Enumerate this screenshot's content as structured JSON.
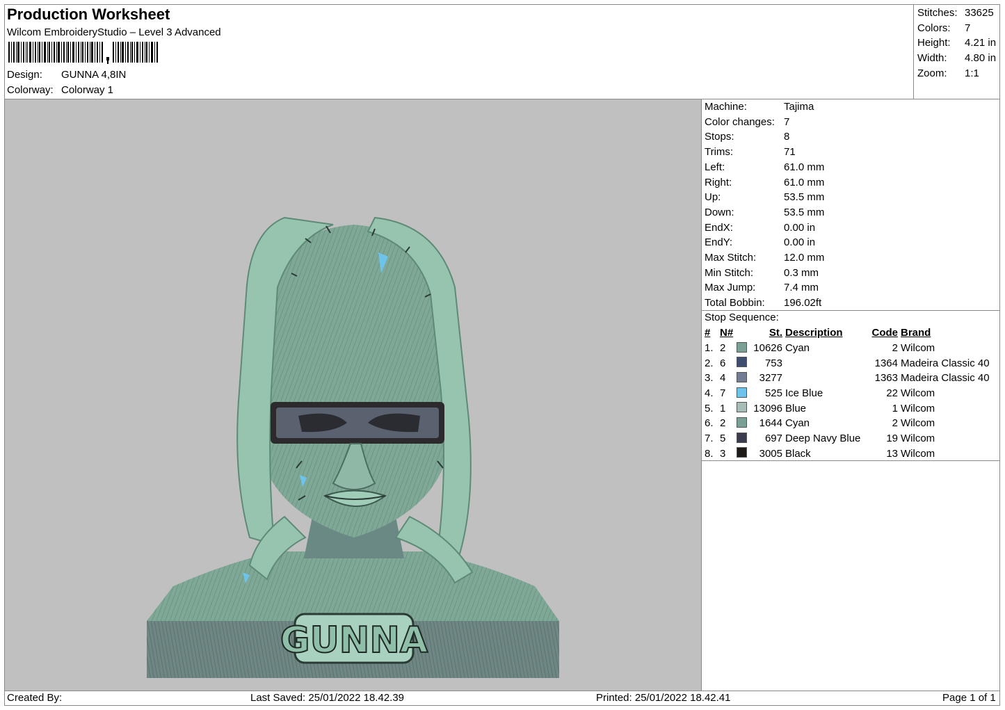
{
  "header": {
    "title": "Production Worksheet",
    "software": "Wilcom EmbroideryStudio – Level 3 Advanced",
    "design_label": "Design:",
    "design_value": "GUNNA 4,8IN",
    "colorway_label": "Colorway:",
    "colorway_value": "Colorway 1"
  },
  "summary": [
    {
      "label": "Stitches:",
      "value": "33625"
    },
    {
      "label": "Colors:",
      "value": "7"
    },
    {
      "label": "Height:",
      "value": "4.21 in"
    },
    {
      "label": "Width:",
      "value": "4.80 in"
    },
    {
      "label": "Zoom:",
      "value": "1:1"
    }
  ],
  "specs": [
    {
      "label": "Machine:",
      "value": "Tajima"
    },
    {
      "label": "Color changes:",
      "value": "7"
    },
    {
      "label": "Stops:",
      "value": "8"
    },
    {
      "label": "Trims:",
      "value": "71"
    },
    {
      "label": "Left:",
      "value": "61.0 mm"
    },
    {
      "label": "Right:",
      "value": "61.0 mm"
    },
    {
      "label": "Up:",
      "value": "53.5 mm"
    },
    {
      "label": "Down:",
      "value": "53.5 mm"
    },
    {
      "label": "EndX:",
      "value": "0.00 in"
    },
    {
      "label": "EndY:",
      "value": "0.00 in"
    },
    {
      "label": "Max Stitch:",
      "value": "12.0 mm"
    },
    {
      "label": "Min Stitch:",
      "value": "0.3 mm"
    },
    {
      "label": "Max Jump:",
      "value": "7.4 mm"
    },
    {
      "label": "Total Bobbin:",
      "value": "196.02ft"
    }
  ],
  "stop_sequence": {
    "label": "Stop Sequence:",
    "columns": [
      "#",
      "N#",
      "St.",
      "Description",
      "Code",
      "Brand"
    ],
    "rows": [
      {
        "idx": "1.",
        "n": "2",
        "color": "#7a9f94",
        "st": "10626",
        "desc": "Cyan",
        "code": "2",
        "brand": "Wilcom"
      },
      {
        "idx": "2.",
        "n": "6",
        "color": "#3d4e6e",
        "st": "753",
        "desc": "",
        "code": "1364",
        "brand": "Madeira Classic 40"
      },
      {
        "idx": "3.",
        "n": "4",
        "color": "#737c93",
        "st": "3277",
        "desc": "",
        "code": "1363",
        "brand": "Madeira Classic 40"
      },
      {
        "idx": "4.",
        "n": "7",
        "color": "#6ec3ea",
        "st": "525",
        "desc": "Ice Blue",
        "code": "22",
        "brand": "Wilcom"
      },
      {
        "idx": "5.",
        "n": "1",
        "color": "#a8bdb8",
        "st": "13096",
        "desc": "Blue",
        "code": "1",
        "brand": "Wilcom"
      },
      {
        "idx": "6.",
        "n": "2",
        "color": "#7a9f94",
        "st": "1644",
        "desc": "Cyan",
        "code": "2",
        "brand": "Wilcom"
      },
      {
        "idx": "7.",
        "n": "5",
        "color": "#3b3b4e",
        "st": "697",
        "desc": "Deep Navy Blue",
        "code": "19",
        "brand": "Wilcom"
      },
      {
        "idx": "8.",
        "n": "3",
        "color": "#1e1a18",
        "st": "3005",
        "desc": "Black",
        "code": "13",
        "brand": "Wilcom"
      }
    ]
  },
  "design_text": "GUNNA",
  "footer": {
    "created_by": "Created By:",
    "last_saved": "Last Saved: 25/01/2022 18.42.39",
    "printed": "Printed: 25/01/2022 18.42.41",
    "page": "Page 1 of 1"
  }
}
